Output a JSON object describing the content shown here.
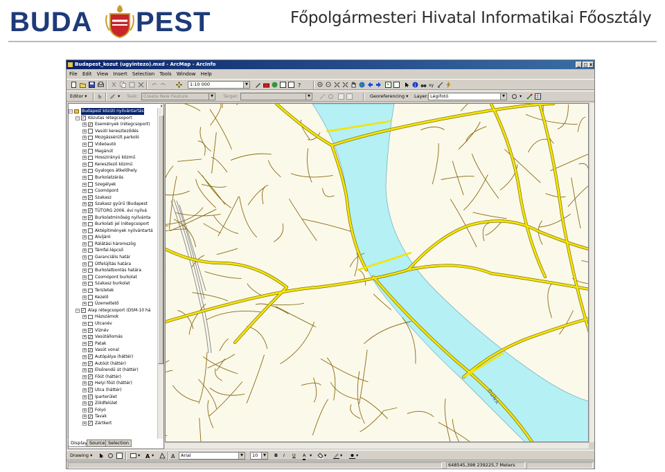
{
  "header": {
    "logo_left": "BUDA",
    "logo_right": "PEST",
    "title": "Főpolgármesteri Hivatal Informatikai Főosztály"
  },
  "window": {
    "title": "Budapest_kozut (ugyintezo).mxd - ArcMap - ArcInfo",
    "min": "_",
    "max": "□",
    "close": "x"
  },
  "menu": [
    "File",
    "Edit",
    "View",
    "Insert",
    "Selection",
    "Tools",
    "Window",
    "Help"
  ],
  "toolbar1": {
    "scale": "1:10 000"
  },
  "toolbar2": {
    "editor_label": "Editor ▾",
    "task_label": "Task:",
    "task_value": "Create New Feature",
    "target_label": "Target:",
    "georef_label": "Georeferencing ▾",
    "layer_label": "Layer:",
    "layer_value": "Légifotó"
  },
  "toc": {
    "close": "x",
    "rows": [
      {
        "level": 0,
        "exp": "−",
        "checked": null,
        "label": "Budapest közúti nyilvántartás",
        "selected": true
      },
      {
        "level": 1,
        "exp": "−",
        "checked": true,
        "label": "Közutas rétegcsoport"
      },
      {
        "level": 2,
        "exp": "+",
        "checked": true,
        "label": "Események (rétegcsoport)"
      },
      {
        "level": 2,
        "exp": "+",
        "checked": false,
        "label": "Vasúti kereszteződés"
      },
      {
        "level": 2,
        "exp": "+",
        "checked": false,
        "label": "Mozgássérült parkoló"
      },
      {
        "level": 2,
        "exp": "+",
        "checked": false,
        "label": "Videóautó"
      },
      {
        "level": 2,
        "exp": "+",
        "checked": false,
        "label": "Magánút"
      },
      {
        "level": 2,
        "exp": "+",
        "checked": false,
        "label": "Hosszirányú közmű"
      },
      {
        "level": 2,
        "exp": "+",
        "checked": false,
        "label": "Keresztező közmű"
      },
      {
        "level": 2,
        "exp": "+",
        "checked": false,
        "label": "Gyalogos átkelőhely"
      },
      {
        "level": 2,
        "exp": "+",
        "checked": false,
        "label": "Burkolatzárás"
      },
      {
        "level": 2,
        "exp": "+",
        "checked": false,
        "label": "Szegélyek"
      },
      {
        "level": 2,
        "exp": "+",
        "checked": false,
        "label": "Csomópont"
      },
      {
        "level": 2,
        "exp": "+",
        "checked": true,
        "label": "Szakasz"
      },
      {
        "level": 2,
        "exp": "+",
        "checked": true,
        "label": "Szakasz gyűrű (Budapest"
      },
      {
        "level": 2,
        "exp": "+",
        "checked": true,
        "label": "TÚTORG 2006. évi nyilvá"
      },
      {
        "level": 2,
        "exp": "+",
        "checked": true,
        "label": "Burkolatminőség nyilvánta"
      },
      {
        "level": 2,
        "exp": "+",
        "checked": false,
        "label": "Burkolati jel (rétegcsoport"
      },
      {
        "level": 2,
        "exp": "+",
        "checked": false,
        "label": "Aktépítmények nyilvántartá"
      },
      {
        "level": 2,
        "exp": "+",
        "checked": false,
        "label": "Aluljáró"
      },
      {
        "level": 2,
        "exp": "+",
        "checked": false,
        "label": "Rálátási háromszög"
      },
      {
        "level": 2,
        "exp": "+",
        "checked": false,
        "label": "Támfal-lépcső"
      },
      {
        "level": 2,
        "exp": "+",
        "checked": false,
        "label": "Garanciális határ"
      },
      {
        "level": 2,
        "exp": "+",
        "checked": false,
        "label": "Útfelújítás határa"
      },
      {
        "level": 2,
        "exp": "+",
        "checked": false,
        "label": "Burkolatbontás határa"
      },
      {
        "level": 2,
        "exp": "+",
        "checked": false,
        "label": "Csomópont burkolat"
      },
      {
        "level": 2,
        "exp": "+",
        "checked": false,
        "label": "Szakasz burkolat"
      },
      {
        "level": 2,
        "exp": "+",
        "checked": false,
        "label": "Területek"
      },
      {
        "level": 2,
        "exp": "+",
        "checked": false,
        "label": "Kezelő"
      },
      {
        "level": 2,
        "exp": "+",
        "checked": false,
        "label": "Üzemeltető"
      },
      {
        "level": 1,
        "exp": "−",
        "checked": true,
        "label": "Alap rétegcsoport (DSM-10 há"
      },
      {
        "level": 2,
        "exp": "+",
        "checked": false,
        "label": "Házszámok"
      },
      {
        "level": 2,
        "exp": "+",
        "checked": false,
        "label": "Utcanév"
      },
      {
        "level": 2,
        "exp": "+",
        "checked": true,
        "label": "Víznév"
      },
      {
        "level": 2,
        "exp": "+",
        "checked": true,
        "label": "Vasútállomás"
      },
      {
        "level": 2,
        "exp": "+",
        "checked": true,
        "label": "Patak"
      },
      {
        "level": 2,
        "exp": "+",
        "checked": true,
        "label": "Vasút vonal"
      },
      {
        "level": 2,
        "exp": "+",
        "checked": true,
        "label": "Autópálya (háttér)"
      },
      {
        "level": 2,
        "exp": "+",
        "checked": true,
        "label": "Autóút (háttér)"
      },
      {
        "level": 2,
        "exp": "+",
        "checked": true,
        "label": "Elsőrendű út (háttér)"
      },
      {
        "level": 2,
        "exp": "+",
        "checked": true,
        "label": "Főút (háttér)"
      },
      {
        "level": 2,
        "exp": "+",
        "checked": true,
        "label": "Helyi főút (háttér)"
      },
      {
        "level": 2,
        "exp": "+",
        "checked": true,
        "label": "Utca (háttér)"
      },
      {
        "level": 2,
        "exp": "+",
        "checked": true,
        "label": "Iparterület"
      },
      {
        "level": 2,
        "exp": "+",
        "checked": true,
        "label": "Zöldfelület"
      },
      {
        "level": 2,
        "exp": "+",
        "checked": true,
        "label": "Folyó"
      },
      {
        "level": 2,
        "exp": "+",
        "checked": true,
        "label": "Tavak"
      },
      {
        "level": 2,
        "exp": "+",
        "checked": true,
        "label": "Zártkert"
      }
    ],
    "tabs": [
      "Display",
      "Source",
      "Selection"
    ]
  },
  "map": {
    "river_label": "DUNA",
    "colors": {
      "background": "#fbf9ea",
      "river": "#b4f0f4",
      "major_road": "#f4e400",
      "minor_road": "#8a6a10",
      "rail": "#777777"
    }
  },
  "drawbar": {
    "drawing_label": "Drawing ▾",
    "font": "Arial",
    "size": "10",
    "bold": "B",
    "italic": "I",
    "underline": "U",
    "font_color": "A"
  },
  "status": {
    "coords": "648545,398  239225,7 Meters"
  }
}
